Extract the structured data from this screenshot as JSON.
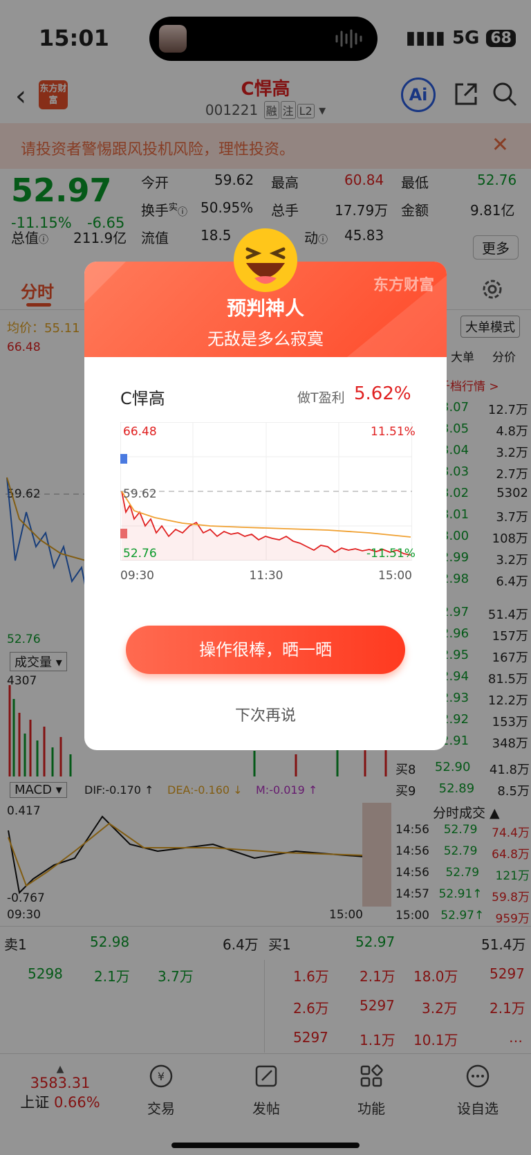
{
  "status": {
    "time": "15:01",
    "network": "5G",
    "battery": "68"
  },
  "header": {
    "stock_name": "C悍高",
    "stock_code": "001221",
    "tags": [
      "融",
      "注",
      "L2"
    ],
    "logo_text": "东方财富",
    "ai_label": "Ai"
  },
  "warning": {
    "text": "请投资者警惕跟风投机风险，理性投资。"
  },
  "quote": {
    "price": "52.97",
    "pct": "-11.15%",
    "change": "-6.65",
    "open_label": "今开",
    "open": "59.62",
    "high_label": "最高",
    "high": "60.84",
    "low_label": "最低",
    "low": "52.76",
    "turnover_label": "换手",
    "turnover_sup": "实",
    "turnover": "50.95%",
    "volume_label": "总手",
    "volume": "17.79万",
    "amount_label": "金额",
    "amount": "9.81亿",
    "mktcap_label": "总值",
    "mktcap": "211.9亿",
    "float_label": "流值",
    "float": "18.5",
    "dyn_label": "动",
    "dyn": "45.83",
    "more": "更多"
  },
  "tabs": {
    "active": "分时"
  },
  "chart": {
    "avg_label": "均价：55.11",
    "big_order": "大单模式",
    "col_big": "大单",
    "col_tick": "分价",
    "book_link": "千档行情 >",
    "y_high": "66.48",
    "y_mid": "59.62",
    "y_low": "52.76",
    "vol_label": "成交量",
    "vol_max": "4307",
    "macd_label": "MACD",
    "dif": "DIF:-0.170 ↑",
    "dea": "DEA:-0.160 ↓",
    "m": "M:-0.019 ↑",
    "macd_high": "0.417",
    "macd_low": "-0.767",
    "t_start": "09:30",
    "t_end": "15:00",
    "ticks_title": "分时成交 ▲"
  },
  "order_book_side": [
    [
      "3.07",
      "12.7万"
    ],
    [
      "3.05",
      "4.8万"
    ],
    [
      "3.04",
      "3.2万"
    ],
    [
      "3.03",
      "2.7万"
    ],
    [
      "3.02",
      "5302"
    ],
    [
      "3.01",
      "3.7万"
    ],
    [
      "3.00",
      "108万"
    ],
    [
      "2.99",
      "3.2万"
    ],
    [
      "2.98",
      "6.4万"
    ],
    [
      "2.97",
      "51.4万"
    ],
    [
      "2.96",
      "157万"
    ],
    [
      "2.95",
      "167万"
    ],
    [
      "2.94",
      "81.5万"
    ],
    [
      "2.93",
      "12.2万"
    ],
    [
      "2.92",
      "153万"
    ],
    [
      "2.91",
      "348万"
    ]
  ],
  "buy_levels": [
    {
      "label": "买8",
      "price": "52.90",
      "vol": "41.8万"
    },
    {
      "label": "买9",
      "price": "52.89",
      "vol": "8.5万"
    }
  ],
  "ticks": [
    {
      "t": "14:56",
      "p": "52.79",
      "v": "74.4万"
    },
    {
      "t": "14:56",
      "p": "52.79",
      "v": "64.8万"
    },
    {
      "t": "14:56",
      "p": "52.79",
      "v": "121万"
    },
    {
      "t": "14:57",
      "p": "52.91↑",
      "v": "59.8万"
    },
    {
      "t": "15:00",
      "p": "52.97↑",
      "v": "959万"
    }
  ],
  "book": {
    "sell1_label": "卖1",
    "sell1_price": "52.98",
    "sell1_vol": "6.4万",
    "buy1_label": "买1",
    "buy1_price": "52.97",
    "buy1_vol": "51.4万",
    "left_row": [
      "5298",
      "2.1万",
      "3.7万"
    ],
    "right_rows": [
      [
        "1.6万",
        "2.1万",
        "18.0万",
        "5297"
      ],
      [
        "2.6万",
        "5297",
        "3.2万",
        "2.1万"
      ],
      [
        "5297",
        "1.1万",
        "10.1万",
        "…"
      ]
    ]
  },
  "bottom_nav": {
    "index_value": "3583.31",
    "index_name": "上证",
    "index_pct": "0.66%",
    "items": [
      "交易",
      "发帖",
      "功能",
      "设自选"
    ]
  },
  "dialog": {
    "brand": "东方财富",
    "title": "预判神人",
    "subtitle": "无敌是多么寂寞",
    "stock": "C悍高",
    "profit_label": "做T盈利",
    "profit": "5.62%",
    "chart_high": "66.48",
    "chart_mid": "59.62",
    "chart_low": "52.76",
    "chart_pct_high": "11.51%",
    "chart_pct_low": "-11.51%",
    "times": [
      "09:30",
      "11:30",
      "15:00"
    ],
    "share_button": "操作很棒，晒一晒",
    "later_button": "下次再说"
  },
  "colors": {
    "accent": "#ff4a2a",
    "up": "#e02020",
    "down": "#0a9a2a"
  }
}
